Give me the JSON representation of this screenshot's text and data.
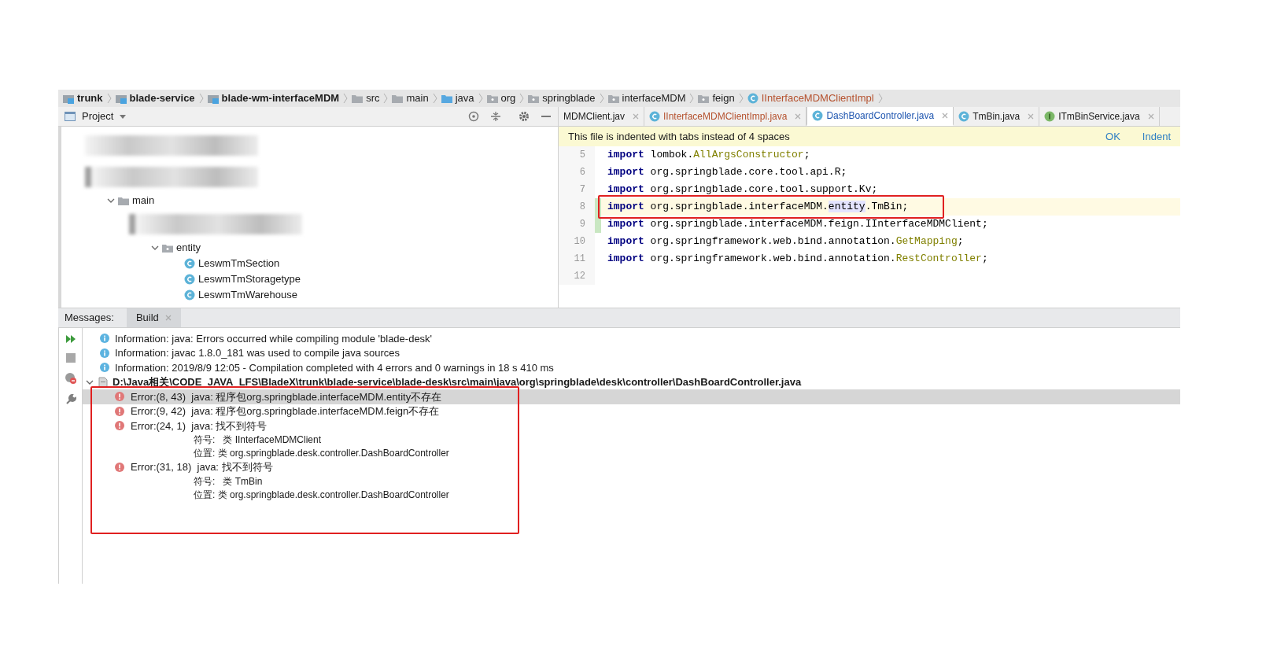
{
  "breadcrumb": [
    {
      "label": "trunk",
      "kind": "module"
    },
    {
      "label": "blade-service",
      "kind": "module"
    },
    {
      "label": "blade-wm-interfaceMDM",
      "kind": "module"
    },
    {
      "label": "src",
      "kind": "folder"
    },
    {
      "label": "main",
      "kind": "folder"
    },
    {
      "label": "java",
      "kind": "source"
    },
    {
      "label": "org",
      "kind": "package"
    },
    {
      "label": "springblade",
      "kind": "package"
    },
    {
      "label": "interfaceMDM",
      "kind": "package"
    },
    {
      "label": "feign",
      "kind": "package"
    },
    {
      "label": "IInterfaceMDMClientImpl",
      "kind": "class"
    }
  ],
  "project": {
    "title": "Project",
    "tree": [
      {
        "kind": "blurred"
      },
      {
        "kind": "blurred",
        "expanded": true,
        "children": [
          {
            "kind": "folder",
            "label": "main",
            "expanded": true,
            "children": [
              {
                "kind": "blurred",
                "expanded": true,
                "children": [
                  {
                    "kind": "package",
                    "label": "entity",
                    "expanded": true,
                    "children": [
                      {
                        "kind": "class",
                        "label": "LeswmTmSection"
                      },
                      {
                        "kind": "class",
                        "label": "LeswmTmStoragetype"
                      },
                      {
                        "kind": "class",
                        "label": "LeswmTmWarehouse"
                      }
                    ]
                  }
                ]
              }
            ]
          }
        ]
      }
    ]
  },
  "editor_tabs": [
    {
      "label": "MDMClient.jav",
      "selected": false,
      "error": false
    },
    {
      "label": "IInterfaceMDMClientImpl.java",
      "kind": "class",
      "selected": false,
      "error": true
    },
    {
      "label": "DashBoardController.java",
      "kind": "class",
      "selected": true,
      "error": false
    },
    {
      "label": "TmBin.java",
      "kind": "class",
      "selected": false,
      "error": false
    },
    {
      "label": "ITmBinService.java",
      "kind": "interface",
      "selected": false,
      "error": false
    }
  ],
  "banner": {
    "text": "This file is indented with tabs instead of 4 spaces",
    "actions": [
      "OK",
      "Indent"
    ]
  },
  "code": [
    {
      "number": "5",
      "current": false,
      "changed": false,
      "annotated": false,
      "tokens": [
        {
          "text": "import",
          "kind": "keyword"
        },
        {
          "text": " lombok.",
          "kind": "plain"
        },
        {
          "text": "AllArgsConstructor",
          "kind": "class"
        },
        {
          "text": ";",
          "kind": "plain"
        }
      ]
    },
    {
      "number": "6",
      "current": false,
      "changed": false,
      "annotated": false,
      "tokens": [
        {
          "text": "import",
          "kind": "keyword"
        },
        {
          "text": " org.springblade.core.tool.api.R;",
          "kind": "plain"
        }
      ]
    },
    {
      "number": "7",
      "current": false,
      "changed": false,
      "annotated": false,
      "tokens": [
        {
          "text": "import",
          "kind": "keyword"
        },
        {
          "text": " org.springblade.core.tool.support.Kv;",
          "kind": "plain"
        }
      ]
    },
    {
      "number": "8",
      "current": true,
      "changed": true,
      "annotated": true,
      "tokens": [
        {
          "text": "import",
          "kind": "keyword"
        },
        {
          "text": " org.springblade.interfaceMDM.",
          "kind": "plain"
        },
        {
          "text": "entity",
          "kind": "highlight"
        },
        {
          "text": ".TmBin;",
          "kind": "plain"
        }
      ]
    },
    {
      "number": "9",
      "current": false,
      "changed": true,
      "annotated": false,
      "tokens": [
        {
          "text": "import",
          "kind": "keyword"
        },
        {
          "text": " org.springblade.interfaceMDM.feign.IInterfaceMDMClient;",
          "kind": "plain"
        }
      ]
    },
    {
      "number": "10",
      "current": false,
      "changed": false,
      "annotated": false,
      "tokens": [
        {
          "text": "import",
          "kind": "keyword"
        },
        {
          "text": " org.springframework.web.bind.annotation.",
          "kind": "plain"
        },
        {
          "text": "GetMapping",
          "kind": "class"
        },
        {
          "text": ";",
          "kind": "plain"
        }
      ]
    },
    {
      "number": "11",
      "current": false,
      "changed": false,
      "annotated": false,
      "tokens": [
        {
          "text": "import",
          "kind": "keyword"
        },
        {
          "text": " org.springframework.web.bind.annotation.",
          "kind": "plain"
        },
        {
          "text": "RestController",
          "kind": "class"
        },
        {
          "text": ";",
          "kind": "plain"
        }
      ]
    },
    {
      "number": "12"
    }
  ],
  "messages": {
    "label": "Messages:",
    "tabs": [
      {
        "label": "Build",
        "selected": true
      }
    ],
    "info": [
      "Information: java: Errors occurred while compiling module 'blade-desk'",
      "Information: javac 1.8.0_181 was used to compile java sources",
      "Information: 2019/8/9 12:05 - Compilation completed with 4 errors and 0 warnings in 18 s 410 ms"
    ],
    "file": {
      "path": "D:\\Java相关\\CODE_JAVA_LFS\\BladeX\\trunk\\blade-service\\blade-desk\\src\\main\\java\\org\\springblade\\desk\\controller\\DashBoardController.java",
      "expanded": true
    },
    "errors_annotated": true,
    "errors": [
      {
        "location": "Error:(8, 43)",
        "text": "java: 程序包org.springblade.interfaceMDM.entity不存在",
        "selected": true
      },
      {
        "location": "Error:(9, 42)",
        "text": "java: 程序包org.springblade.interfaceMDM.feign不存在",
        "selected": false
      },
      {
        "location": "Error:(24, 1)",
        "text": "java: 找不到符号",
        "selected": false,
        "details": [
          "符号:   类 IInterfaceMDMClient",
          "位置: 类 org.springblade.desk.controller.DashBoardController"
        ]
      },
      {
        "location": "Error:(31, 18)",
        "text": "java: 找不到符号",
        "selected": false,
        "details": [
          "符号:   类 TmBin",
          "位置: 类 org.springblade.desk.controller.DashBoardController"
        ]
      }
    ]
  }
}
